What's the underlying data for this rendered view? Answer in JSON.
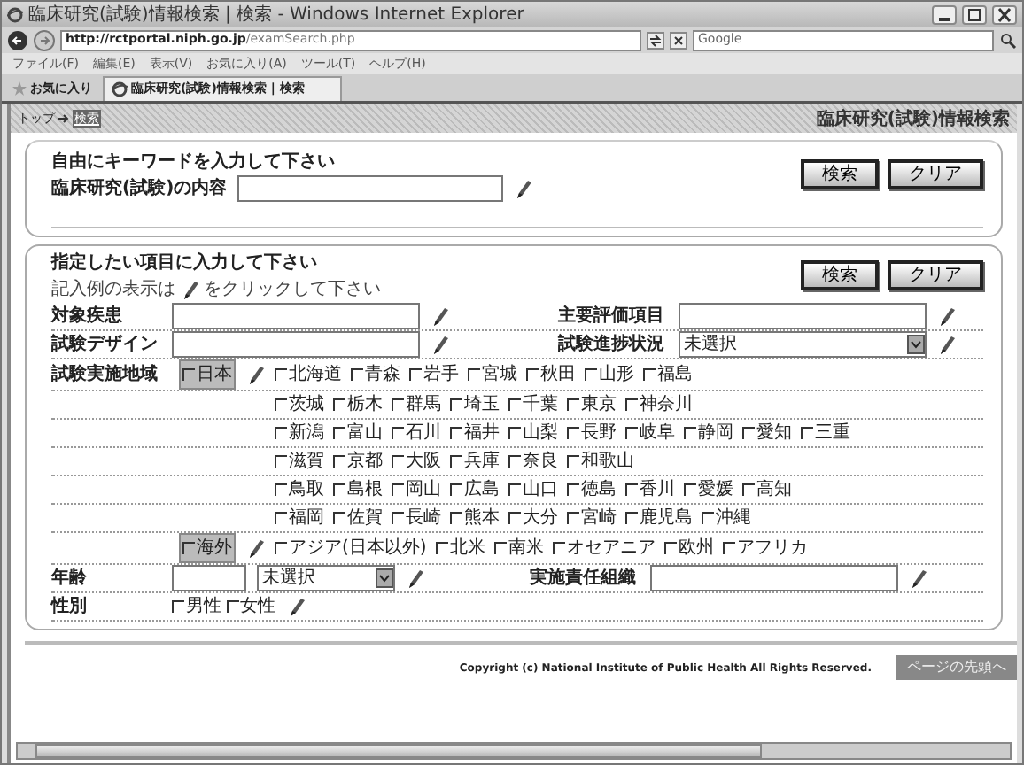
{
  "window": {
    "title": "臨床研究(試験)情報検索 | 検索 - Windows Internet Explorer"
  },
  "address_bar": {
    "url_host": "http://rctportal.niph.go.jp",
    "url_path": "/examSearch.php",
    "search_placeholder": "Google"
  },
  "menu": [
    "ファイル(F)",
    "編集(E)",
    "表示(V)",
    "お気に入り(A)",
    "ツール(T)",
    "ヘルプ(H)"
  ],
  "favorites": "お気に入り",
  "tabs": [
    {
      "label": "臨床研究(試験)情報検索 | 検索",
      "selected": true
    }
  ],
  "breadcrumb": [
    {
      "label": "トップ",
      "selected": false
    },
    {
      "label": "検索",
      "selected": true
    }
  ],
  "page_title": "臨床研究(試験)情報検索",
  "keyword_section": {
    "heading": "自由にキーワードを入力して下さい",
    "field_label": "臨床研究(試験)の内容",
    "buttons": [
      "検索",
      "クリア"
    ]
  },
  "detail_section": {
    "heading": "指定したい項目に入力して下さい",
    "hint_before": "記入例の表示は",
    "hint_after": "をクリックして下さい",
    "buttons": [
      "検索",
      "クリア"
    ],
    "fields": [
      {
        "label": "対象疾患",
        "kind": "text"
      },
      {
        "label": "主要評価項目",
        "kind": "text"
      },
      {
        "label": "試験デザイン",
        "kind": "text"
      },
      {
        "label": "試験進捗状況",
        "kind": "select",
        "value": "未選択"
      }
    ],
    "region": {
      "label": "試験実施地域",
      "groups": [
        {
          "label": "日本",
          "checked": false,
          "rows": [
            [
              {
                "label": "北海道",
                "checked": false
              },
              {
                "label": "青森",
                "checked": false
              },
              {
                "label": "岩手",
                "checked": false
              },
              {
                "label": "宮城",
                "checked": false
              },
              {
                "label": "秋田",
                "checked": false
              },
              {
                "label": "山形",
                "checked": false
              },
              {
                "label": "福島",
                "checked": false
              }
            ],
            [
              {
                "label": "茨城",
                "checked": false
              },
              {
                "label": "栃木",
                "checked": false
              },
              {
                "label": "群馬",
                "checked": false
              },
              {
                "label": "埼玉",
                "checked": false
              },
              {
                "label": "千葉",
                "checked": false
              },
              {
                "label": "東京",
                "checked": false
              },
              {
                "label": "神奈川",
                "checked": false
              }
            ],
            [
              {
                "label": "新潟",
                "checked": false
              },
              {
                "label": "富山",
                "checked": false
              },
              {
                "label": "石川",
                "checked": false
              },
              {
                "label": "福井",
                "checked": false
              },
              {
                "label": "山梨",
                "checked": false
              },
              {
                "label": "長野",
                "checked": false
              },
              {
                "label": "岐阜",
                "checked": false
              },
              {
                "label": "静岡",
                "checked": false
              },
              {
                "label": "愛知",
                "checked": false
              },
              {
                "label": "三重",
                "checked": false
              }
            ],
            [
              {
                "label": "滋賀",
                "checked": false
              },
              {
                "label": "京都",
                "checked": false
              },
              {
                "label": "大阪",
                "checked": false
              },
              {
                "label": "兵庫",
                "checked": false
              },
              {
                "label": "奈良",
                "checked": false
              },
              {
                "label": "和歌山",
                "checked": false
              }
            ],
            [
              {
                "label": "鳥取",
                "checked": false
              },
              {
                "label": "島根",
                "checked": false
              },
              {
                "label": "岡山",
                "checked": false
              },
              {
                "label": "広島",
                "checked": false
              },
              {
                "label": "山口",
                "checked": false
              },
              {
                "label": "徳島",
                "checked": false
              },
              {
                "label": "香川",
                "checked": false
              },
              {
                "label": "愛媛",
                "checked": false
              },
              {
                "label": "高知",
                "checked": false
              }
            ],
            [
              {
                "label": "福岡",
                "checked": false
              },
              {
                "label": "佐賀",
                "checked": false
              },
              {
                "label": "長崎",
                "checked": false
              },
              {
                "label": "熊本",
                "checked": false
              },
              {
                "label": "大分",
                "checked": false
              },
              {
                "label": "宮崎",
                "checked": false
              },
              {
                "label": "鹿児島",
                "checked": false
              },
              {
                "label": "沖縄",
                "checked": false
              }
            ]
          ]
        },
        {
          "label": "海外",
          "checked": false,
          "rows": [
            [
              {
                "label": "アジア(日本以外)",
                "checked": false
              },
              {
                "label": "北米",
                "checked": false
              },
              {
                "label": "南米",
                "checked": false
              },
              {
                "label": "オセアニア",
                "checked": false
              },
              {
                "label": "欧州",
                "checked": false
              },
              {
                "label": "アフリカ",
                "checked": false
              }
            ]
          ]
        }
      ]
    },
    "age": {
      "label": "年齢",
      "select_value": "未選択"
    },
    "organization": {
      "label": "実施責任組織"
    },
    "sex": {
      "label": "性別",
      "options": [
        {
          "label": "男性",
          "checked": false
        },
        {
          "label": "女性",
          "checked": false
        }
      ]
    }
  },
  "footer": {
    "copyright": "Copyright (c) National Institute of Public Health All Rights Reserved.",
    "top_link": "ページの先頭へ"
  }
}
